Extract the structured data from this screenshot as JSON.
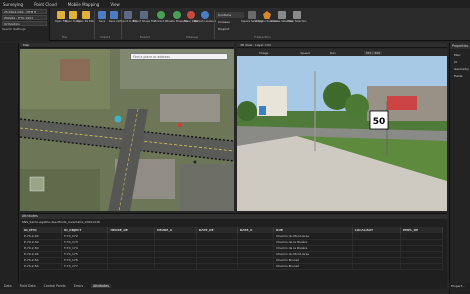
{
  "menu": [
    "Surveying",
    "Point Cloud",
    "Mobile Mapping",
    "View"
  ],
  "left_panel": {
    "project_select": "25-TR02-CRS - NTM 8",
    "cs_select": "WGS84 - HTG 1991",
    "third_select": "Orthoptics",
    "settings_label": "Search Settings"
  },
  "ribbon": {
    "buttons": [
      {
        "label": "Open File",
        "icon": "open-file-icon",
        "color": "#e0b23a"
      },
      {
        "label": "Open Folder",
        "icon": "open-folder-icon",
        "color": "#e0b23a"
      },
      {
        "label": "Open KS Data",
        "icon": "open-data-icon",
        "color": "#e0b23a"
      },
      {
        "label": "Save",
        "icon": "save-icon",
        "color": "#4c7dc4"
      },
      {
        "label": "Save As",
        "icon": "save-as-icon",
        "color": "#4c7dc4"
      },
      {
        "label": "Export to GIS",
        "icon": "export-gis-icon",
        "color": "#5a6a82"
      },
      {
        "label": "Export Shape File",
        "icon": "export-shape-icon",
        "color": "#5a6a82"
      },
      {
        "label": "Extract ID",
        "icon": "extract-icon",
        "color": "#4ca055"
      },
      {
        "label": "Create Shapefile",
        "icon": "create-shapefile-icon",
        "color": "#4ca055"
      },
      {
        "label": "Clear Data",
        "icon": "clear-icon",
        "color": "#c84a3a"
      },
      {
        "label": "Refresh Linework",
        "icon": "refresh-icon",
        "color": "#4c7dc4"
      }
    ],
    "groups": [
      "File",
      "Import",
      "Export",
      "Cleanup"
    ],
    "compare": [
      "Contains",
      "Crosses",
      "Disjoint"
    ],
    "select_buttons": [
      {
        "label": "Square Selection",
        "icon": "square-selection-icon",
        "color": "#6a6a6a"
      },
      {
        "label": "Polygon Selection",
        "icon": "polygon-selection-icon",
        "color": "#d9892a"
      },
      {
        "label": "Inverse Selection",
        "icon": "inverse-selection-icon",
        "color": "#8a8a8a"
      },
      {
        "label": "Clear Selection",
        "icon": "clear-selection-icon",
        "color": "#8a8a8a"
      }
    ],
    "select_group": "T-Selection"
  },
  "map_panel": {
    "title": "Map",
    "search_placeholder": "Find a place or address"
  },
  "street_panel": {
    "title": "3D View · Layer: Info",
    "image_label": "Image",
    "speed_label": "Speed",
    "run_label": "Run",
    "frame_value": "355 / 399"
  },
  "properties": {
    "title": "Properties",
    "items": [
      "Misc",
      "Id",
      "Geometry",
      "Fields"
    ]
  },
  "attributes": {
    "title": "Attributes",
    "layer": "SNS_Santo-Agathe-des-Monts_inventaire_20221216",
    "columns": [
      "ID_MTQ",
      "ID_OBJECT",
      "HEURE_DE",
      "HEURE_A",
      "DATE_DE",
      "DATE_A",
      "RUE",
      "LOCALISAT",
      "EMPL_DE"
    ],
    "rows": [
      [
        "P-70-2-40",
        "T-70_172",
        "",
        "",
        "",
        "",
        "Chemin du Mont-Gras",
        "",
        ""
      ],
      [
        "P-70-2-50",
        "T-70_173",
        "",
        "",
        "",
        "",
        "Chemin de la Rivière",
        "",
        ""
      ],
      [
        "P-70-2-50",
        "T-70_174",
        "",
        "",
        "",
        "",
        "Chemin de la Rivière",
        "",
        ""
      ],
      [
        "P-70-2-40",
        "T-70_175",
        "",
        "",
        "",
        "",
        "Chemin du Mont-Gras",
        "",
        ""
      ],
      [
        "P-70-2-50",
        "T-70_176",
        "",
        "",
        "",
        "",
        "Chemin Brunet",
        "",
        ""
      ],
      [
        "P-70-2-50",
        "T-70_177",
        "",
        "",
        "",
        "",
        "Chemin Brunet",
        "",
        ""
      ]
    ]
  },
  "bottom_tabs": [
    "Data",
    "Field Data",
    "Control Points",
    "Errors",
    "Attributes"
  ],
  "bottom_right_tab": "Propert...",
  "sign": {
    "speed": "50"
  }
}
